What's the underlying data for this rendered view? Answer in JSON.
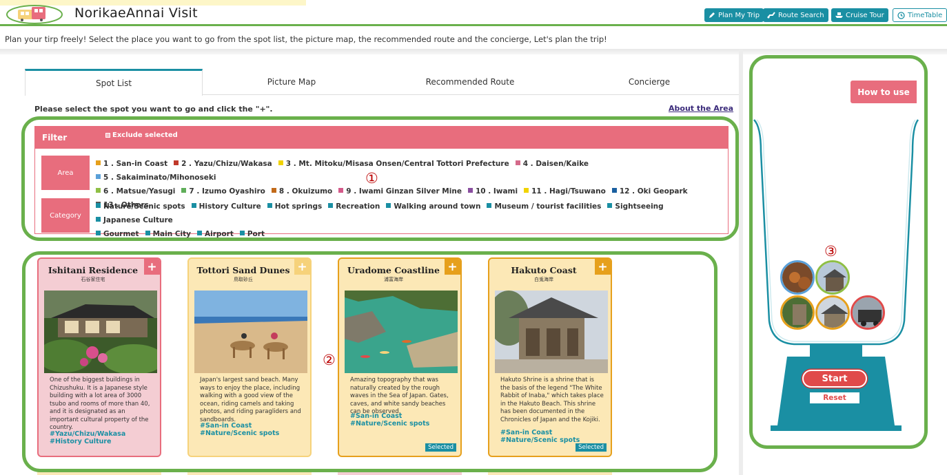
{
  "header": {
    "site_title": "NorikaeAnnai Visit",
    "buttons": [
      {
        "label": "Plan My Trip",
        "icon": "pencil-icon"
      },
      {
        "label": "Route Search",
        "icon": "route-icon"
      },
      {
        "label": "Cruise Tour",
        "icon": "ship-icon"
      },
      {
        "label": "TimeTable",
        "icon": "clock-icon"
      }
    ]
  },
  "intro": "Plan your tirp freely! Select the place you want to go from the spot list, the picture map, the recommended route and the concierge, Let's plan the trip!",
  "tabs": [
    {
      "label": "Spot List",
      "active": true
    },
    {
      "label": "Picture Map",
      "active": false
    },
    {
      "label": "Recommended Route",
      "active": false
    },
    {
      "label": "Concierge",
      "active": false
    }
  ],
  "instruction": "Please select the spot you want to go and click the \"+\".",
  "about_link": "About the Area",
  "filter": {
    "title": "Filter",
    "exclude_label": "Exclude selected",
    "area_label": "Area",
    "category_label": "Category",
    "areas": [
      {
        "label": "1 . San-in Coast",
        "color": "#e6a01c"
      },
      {
        "label": "2 . Yazu/Chizu/Wakasa",
        "color": "#c0392b"
      },
      {
        "label": "3 . Mt. Mitoku/Misasa Onsen/Central Tottori Prefecture",
        "color": "#f1d300"
      },
      {
        "label": "4 . Daisen/Kaike",
        "color": "#d46a8a"
      },
      {
        "label": "5 . Sakaiminato/Mihonoseki",
        "color": "#5aa0d8"
      },
      {
        "label": "6 . Matsue/Yasugi",
        "color": "#8fbf45"
      },
      {
        "label": "7 . Izumo Oyashiro",
        "color": "#5fae5a"
      },
      {
        "label": "8 . Okuizumo",
        "color": "#c26a1a"
      },
      {
        "label": "9 . Iwami Ginzan Silver Mine",
        "color": "#d45a8a"
      },
      {
        "label": "10 . Iwami",
        "color": "#8a4fa0"
      },
      {
        "label": "11 . Hagi/Tsuwano",
        "color": "#f1d300"
      },
      {
        "label": "12 . Oki Geopark",
        "color": "#1a5fa0"
      },
      {
        "label": "13 . Others",
        "color": "#555555"
      }
    ],
    "categories": [
      "Nature/Scenic spots",
      "History Culture",
      "Hot springs",
      "Recreation",
      "Walking around town",
      "Museum / tourist facilities",
      "Sightseeing",
      "Japanese Culture",
      "Gourmet",
      "Main City",
      "Airport",
      "Port"
    ],
    "category_color": "#1a8fa3"
  },
  "annotations": {
    "one": "①",
    "two": "②",
    "three": "③"
  },
  "cards": [
    {
      "title": "Ishitani Residence",
      "jp": "石谷家住宅",
      "desc": "One of the biggest buildings in Chizushuku. It is a Japanese style building with a lot area of 3000 tsubo and rooms of more than 40, and it is designated as an important cultural property of the country.",
      "tags": "#Yazu/Chizu/Wakasa #History Culture",
      "selected": ""
    },
    {
      "title": "Tottori Sand Dunes",
      "jp": "鳥取砂丘",
      "desc": "Japan's largest sand beach. Many ways to enjoy the place, including walking with a good view of the ocean, riding camels and taking photos, and riding paragliders and sandboards.",
      "tags": "#San-in Coast #Nature/Scenic spots",
      "selected": ""
    },
    {
      "title": "Uradome Coastline",
      "jp": "浦富海岸",
      "desc": "Amazing topography that was naturally created by the rough waves in the Sea of Japan. Gates, caves, and white sandy beaches can be observed.",
      "tags": "#San-in Coast #Nature/Scenic spots",
      "selected": "Selected"
    },
    {
      "title": "Hakuto Coast",
      "jp": "白兎海岸",
      "desc": "Hakuto Shrine is a shrine that is the basis of the legend \"The White Rabbit of Inaba,\" which takes place in the Hakuto Beach. This shrine has been documented in the Chronicles of Japan and the Kojiki.",
      "tags": "#San-in Coast #Nature/Scenic spots",
      "selected": "Selected"
    }
  ],
  "sidebar": {
    "how_to_use": "How to use",
    "start": "Start",
    "reset": "Reset"
  },
  "plus": "+"
}
